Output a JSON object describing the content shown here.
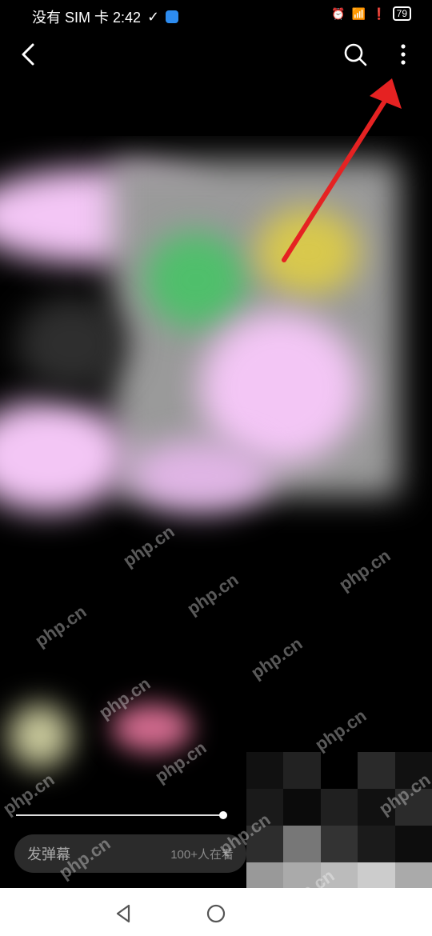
{
  "status_bar": {
    "carrier_and_time": "没有 SIM 卡 2:42",
    "battery": "79"
  },
  "danmaku": {
    "placeholder": "发弹幕",
    "viewer_count": "100+人在看"
  },
  "watermark": "php.cn",
  "icons": {
    "back": "chevron-left-icon",
    "search": "search-icon",
    "more": "more-vertical-icon",
    "nav_back": "triangle-back-icon",
    "nav_home": "circle-home-icon"
  },
  "colors": {
    "annotation_arrow": "#e52222",
    "pink": "#f3c6f5"
  }
}
